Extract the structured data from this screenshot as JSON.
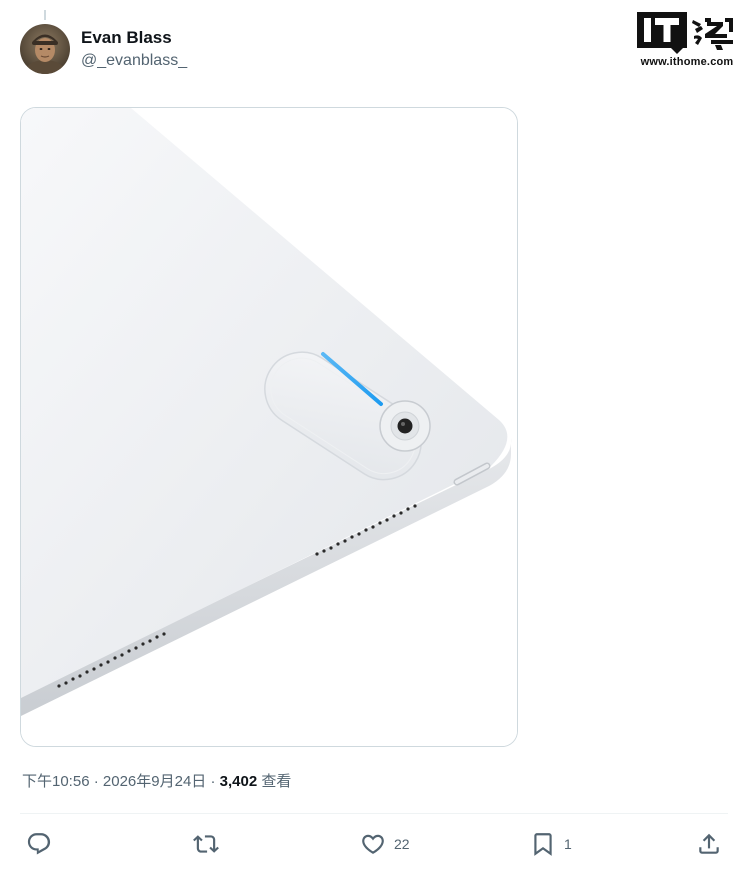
{
  "author": {
    "display_name": "Evan Blass",
    "handle": "@_evanblass_",
    "avatar_icon": "profile-photo"
  },
  "watermark": {
    "logo_text": "IT之家",
    "url": "www.ithome.com"
  },
  "media": {
    "description_icon": "tablet-photo"
  },
  "meta": {
    "time": "下午10:56",
    "separator1": " · ",
    "date": "2026年9月24日",
    "separator2": " · ",
    "views_count": "3,402",
    "views_label": " 查看"
  },
  "actions": {
    "reply": {
      "icon": "reply-icon",
      "count": ""
    },
    "retweet": {
      "icon": "retweet-icon",
      "count": ""
    },
    "like": {
      "icon": "heart-icon",
      "count": "22"
    },
    "bookmark": {
      "icon": "bookmark-icon",
      "count": "1"
    },
    "share": {
      "icon": "share-icon",
      "count": ""
    }
  },
  "colors": {
    "text_primary": "#0f1419",
    "text_secondary": "#536471",
    "border": "#cfd9de",
    "led_accent": "#1d9bf0"
  }
}
